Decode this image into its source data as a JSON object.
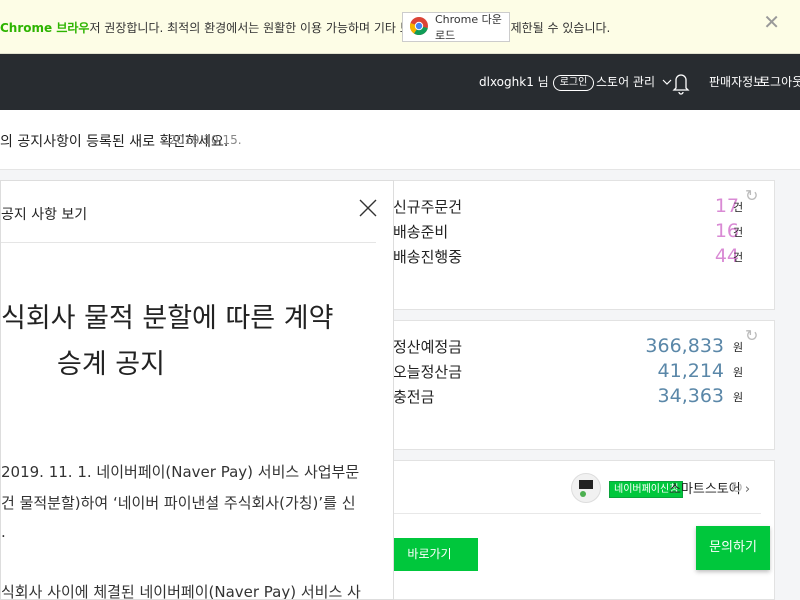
{
  "notice": {
    "text_highlight": "Chrome 브라우",
    "text_rest": "저 권장합니다. 최적의 환경에서는 원활한 이용 가능하며 기타 브라우저 에서 일부가 제한될 수 있습니다.",
    "button_label": "Chrome 다운로드"
  },
  "topbar": {
    "user": "dlxoghk1 님",
    "user_badge": "로그인",
    "menu_label": "스토어 관리",
    "link_1": "판매자정보",
    "link_2": "로그아웃"
  },
  "subhead": {
    "text": "의 공지사항이 등록된 새로 확인하세요.",
    "date": "2019.10.15."
  },
  "card1": {
    "rows": [
      {
        "label": "신규주문건",
        "value": "17",
        "unit": "건"
      },
      {
        "label": "배송준비",
        "value": "16",
        "unit": "건"
      },
      {
        "label": "배송진행중",
        "value": "44",
        "unit": "건"
      }
    ]
  },
  "card2": {
    "rows": [
      {
        "label": "정산예정금",
        "value": "366,833",
        "unit": "원"
      },
      {
        "label": "오늘정산금",
        "value": "41,214",
        "unit": "원"
      },
      {
        "label": "충전금",
        "value": "34,363",
        "unit": "원"
      }
    ]
  },
  "card3": {
    "badge": "네이버페이신청",
    "link": "스마트스토어",
    "button": "바로가기"
  },
  "modal": {
    "header": "공지 사항 보기",
    "title_line1": "식회사 물적 분할에 따른 계약",
    "title_line2": "승계 공지",
    "body_line1": "2019. 11. 1. 네이버페이(Naver Pay) 서비스 사업부문",
    "body_line2": "건 물적분할)하여 ‘네이버 파이낸셜 주식회사(가칭)’를 신",
    "body_line3": ".",
    "body_line4": "식회사 사이에 체결된 네이버페이(Naver Pay) 서비스 사"
  },
  "float_button": "문의하기",
  "colors": {
    "accent_green": "#00c73c",
    "topbar_bg": "#282c30",
    "order_value": "#d98ad4",
    "money_value": "#5a87a8"
  }
}
